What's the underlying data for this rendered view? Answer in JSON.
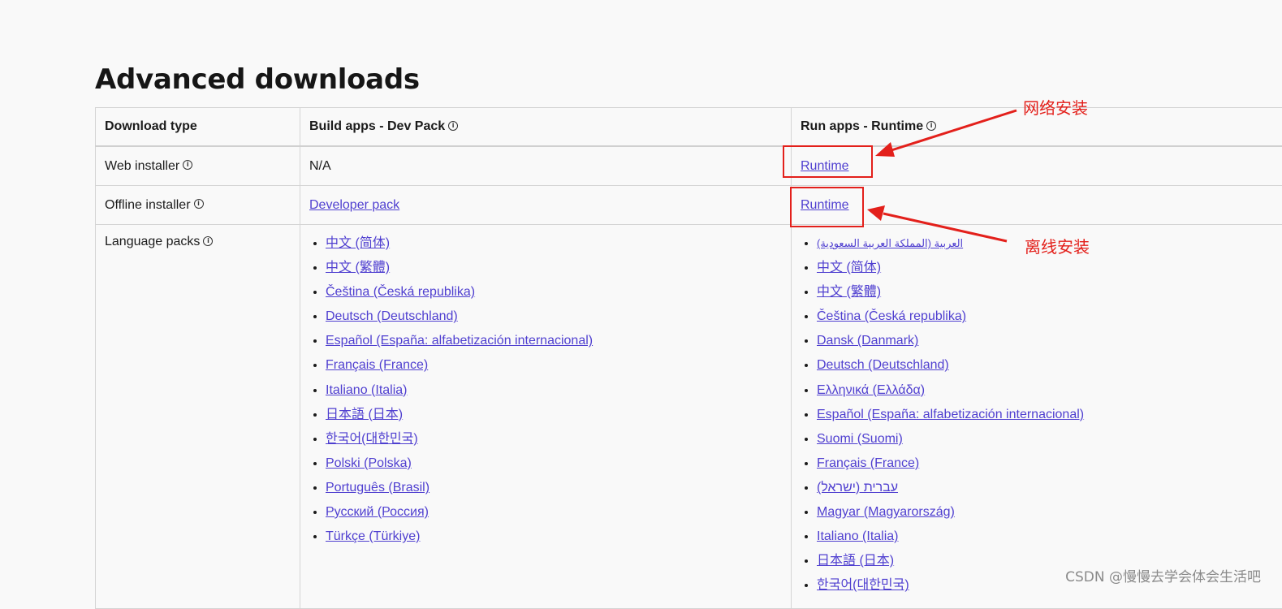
{
  "page": {
    "title": "Advanced downloads"
  },
  "table": {
    "headers": {
      "download_type": "Download type",
      "dev_pack": "Build apps - Dev Pack",
      "runtime": "Run apps - Runtime"
    },
    "rows": {
      "web": {
        "label": "Web installer",
        "dev": "N/A",
        "runtime": "Runtime"
      },
      "offline": {
        "label": "Offline installer",
        "dev": "Developer pack",
        "runtime": "Runtime"
      },
      "lang": {
        "label": "Language packs"
      }
    },
    "info_icon": "info-icon"
  },
  "dev_languages": [
    "中文 (简体)",
    "中文 (繁體)",
    "Čeština (Česká republika)",
    "Deutsch (Deutschland)",
    "Español (España: alfabetización internacional)",
    "Français (France)",
    "Italiano (Italia)",
    "日本語 (日本)",
    "한국어(대한민국)",
    "Polski (Polska)",
    "Português (Brasil)",
    "Русский (Россия)",
    "Türkçe (Türkiye)"
  ],
  "runtime_languages": [
    "العربية (المملكة العربية السعودية)",
    "中文 (简体)",
    "中文 (繁體)",
    "Čeština (Česká republika)",
    "Dansk (Danmark)",
    "Deutsch (Deutschland)",
    "Ελληνικά (Ελλάδα)",
    "Español (España: alfabetización internacional)",
    "Suomi (Suomi)",
    "Français (France)",
    "עברית (ישראל)",
    "Magyar (Magyarország)",
    "Italiano (Italia)",
    "日本語 (日本)",
    "한국어(대한민국)"
  ],
  "annotations": {
    "web_label": "网络安装",
    "offline_label": "离线安装",
    "color": "#e3201b"
  },
  "watermark": "CSDN @慢慢去学会体会生活吧",
  "colors": {
    "link": "#4f3fd0",
    "background": "#f9f9f9",
    "border": "#d4d4d4"
  }
}
